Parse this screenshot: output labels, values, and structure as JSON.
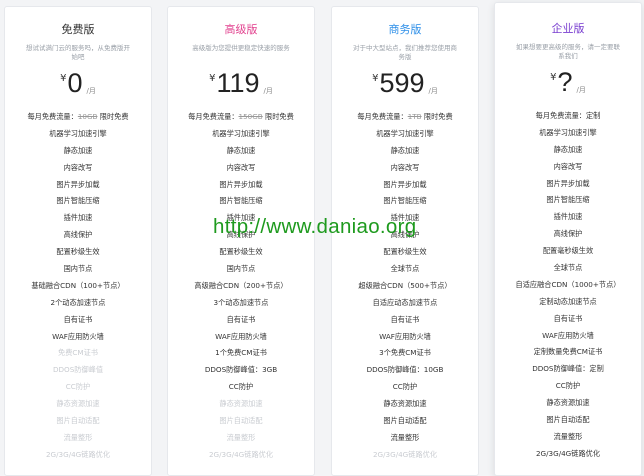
{
  "colors": {
    "free": "#333333",
    "advanced": "#e2428f",
    "business": "#2e8fe8",
    "enterprise": "#7a3fd0",
    "watermark": "#1e9a1e"
  },
  "plans": [
    {
      "name": "免费版",
      "desc": "想试试满门云的服务吗，从免费版开始吧",
      "currency": "¥",
      "price": "0",
      "unit": "/月",
      "features": [
        {
          "text": "每月免费流量：10GB 限时免费",
          "pre": "每月免费流量：",
          "strike": "10GB",
          "post": " 限时免费",
          "on": true
        },
        {
          "text": "机器学习加速引擎",
          "on": true
        },
        {
          "text": "静态加速",
          "on": true
        },
        {
          "text": "内容改写",
          "on": true
        },
        {
          "text": "图片异步加载",
          "on": true
        },
        {
          "text": "图片智能压缩",
          "on": true
        },
        {
          "text": "插件加速",
          "on": true
        },
        {
          "text": "高线保护",
          "on": true
        },
        {
          "text": "配置秒级生效",
          "on": true
        },
        {
          "text": "国内节点",
          "on": true
        },
        {
          "text": "基础融合CDN（100+节点）",
          "on": true
        },
        {
          "text": "2个动态加速节点",
          "on": true
        },
        {
          "text": "自有证书",
          "on": true
        },
        {
          "text": "WAF应用防火墙",
          "on": true
        },
        {
          "text": "免费CM证书",
          "on": false
        },
        {
          "text": "DDOS防御峰值",
          "on": false
        },
        {
          "text": "CC防护",
          "on": false
        },
        {
          "text": "静态资源加速",
          "on": false
        },
        {
          "text": "图片自动适配",
          "on": false
        },
        {
          "text": "流量整形",
          "on": false
        },
        {
          "text": "2G/3G/4G链路优化",
          "on": false
        }
      ]
    },
    {
      "name": "高级版",
      "desc": "高级版为您提供更稳定快速的服务",
      "currency": "¥",
      "price": "119",
      "unit": "/月",
      "features": [
        {
          "text": "每月免费流量：150GB 限时免费",
          "pre": "每月免费流量：",
          "strike": "150GB",
          "post": " 限时免费",
          "on": true
        },
        {
          "text": "机器学习加速引擎",
          "on": true
        },
        {
          "text": "静态加速",
          "on": true
        },
        {
          "text": "内容改写",
          "on": true
        },
        {
          "text": "图片异步加载",
          "on": true
        },
        {
          "text": "图片智能压缩",
          "on": true
        },
        {
          "text": "插件加速",
          "on": true
        },
        {
          "text": "高线保护",
          "on": true
        },
        {
          "text": "配置秒级生效",
          "on": true
        },
        {
          "text": "国内节点",
          "on": true
        },
        {
          "text": "高级融合CDN（200+节点）",
          "on": true
        },
        {
          "text": "3个动态加速节点",
          "on": true
        },
        {
          "text": "自有证书",
          "on": true
        },
        {
          "text": "WAF应用防火墙",
          "on": true
        },
        {
          "text": "1个免费CM证书",
          "on": true
        },
        {
          "text": "DDOS防御峰值：3GB",
          "on": true
        },
        {
          "text": "CC防护",
          "on": true
        },
        {
          "text": "静态资源加速",
          "on": false
        },
        {
          "text": "图片自动适配",
          "on": false
        },
        {
          "text": "流量整形",
          "on": false
        },
        {
          "text": "2G/3G/4G链路优化",
          "on": false
        }
      ]
    },
    {
      "name": "商务版",
      "desc": "对于中大型站点，我们推荐您使用商务版",
      "currency": "¥",
      "price": "599",
      "unit": "/月",
      "features": [
        {
          "text": "每月免费流量：1TB 限时免费",
          "pre": "每月免费流量：",
          "strike": "1TB",
          "post": " 限时免费",
          "on": true
        },
        {
          "text": "机器学习加速引擎",
          "on": true
        },
        {
          "text": "静态加速",
          "on": true
        },
        {
          "text": "内容改写",
          "on": true
        },
        {
          "text": "图片异步加载",
          "on": true
        },
        {
          "text": "图片智能压缩",
          "on": true
        },
        {
          "text": "插件加速",
          "on": true
        },
        {
          "text": "高线保护",
          "on": true
        },
        {
          "text": "配置秒级生效",
          "on": true
        },
        {
          "text": "全球节点",
          "on": true
        },
        {
          "text": "超级融合CDN（500+节点）",
          "on": true
        },
        {
          "text": "自适应动态加速节点",
          "on": true
        },
        {
          "text": "自有证书",
          "on": true
        },
        {
          "text": "WAF应用防火墙",
          "on": true
        },
        {
          "text": "3个免费CM证书",
          "on": true
        },
        {
          "text": "DDOS防御峰值：10GB",
          "on": true
        },
        {
          "text": "CC防护",
          "on": true
        },
        {
          "text": "静态资源加速",
          "on": true
        },
        {
          "text": "图片自动适配",
          "on": true
        },
        {
          "text": "流量整形",
          "on": true
        },
        {
          "text": "2G/3G/4G链路优化",
          "on": false
        }
      ]
    },
    {
      "name": "企业版",
      "desc": "如果想要更高级的服务，请一定要联系我们",
      "currency": "¥",
      "price": "?",
      "unit": "/月",
      "features": [
        {
          "text": "每月免费流量：定制",
          "on": true
        },
        {
          "text": "机器学习加速引擎",
          "on": true
        },
        {
          "text": "静态加速",
          "on": true
        },
        {
          "text": "内容改写",
          "on": true
        },
        {
          "text": "图片异步加载",
          "on": true
        },
        {
          "text": "图片智能压缩",
          "on": true
        },
        {
          "text": "插件加速",
          "on": true
        },
        {
          "text": "高线保护",
          "on": true
        },
        {
          "text": "配置毫秒级生效",
          "on": true
        },
        {
          "text": "全球节点",
          "on": true
        },
        {
          "text": "自适应融合CDN（1000+节点）",
          "on": true
        },
        {
          "text": "定制动态加速节点",
          "on": true
        },
        {
          "text": "自有证书",
          "on": true
        },
        {
          "text": "WAF应用防火墙",
          "on": true
        },
        {
          "text": "定制数量免费CM证书",
          "on": true
        },
        {
          "text": "DDOS防御峰值：定制",
          "on": true
        },
        {
          "text": "CC防护",
          "on": true
        },
        {
          "text": "静态资源加速",
          "on": true
        },
        {
          "text": "图片自动适配",
          "on": true
        },
        {
          "text": "流量整形",
          "on": true
        },
        {
          "text": "2G/3G/4G链路优化",
          "on": true
        }
      ]
    }
  ],
  "watermark": "http://www.daniao.org"
}
